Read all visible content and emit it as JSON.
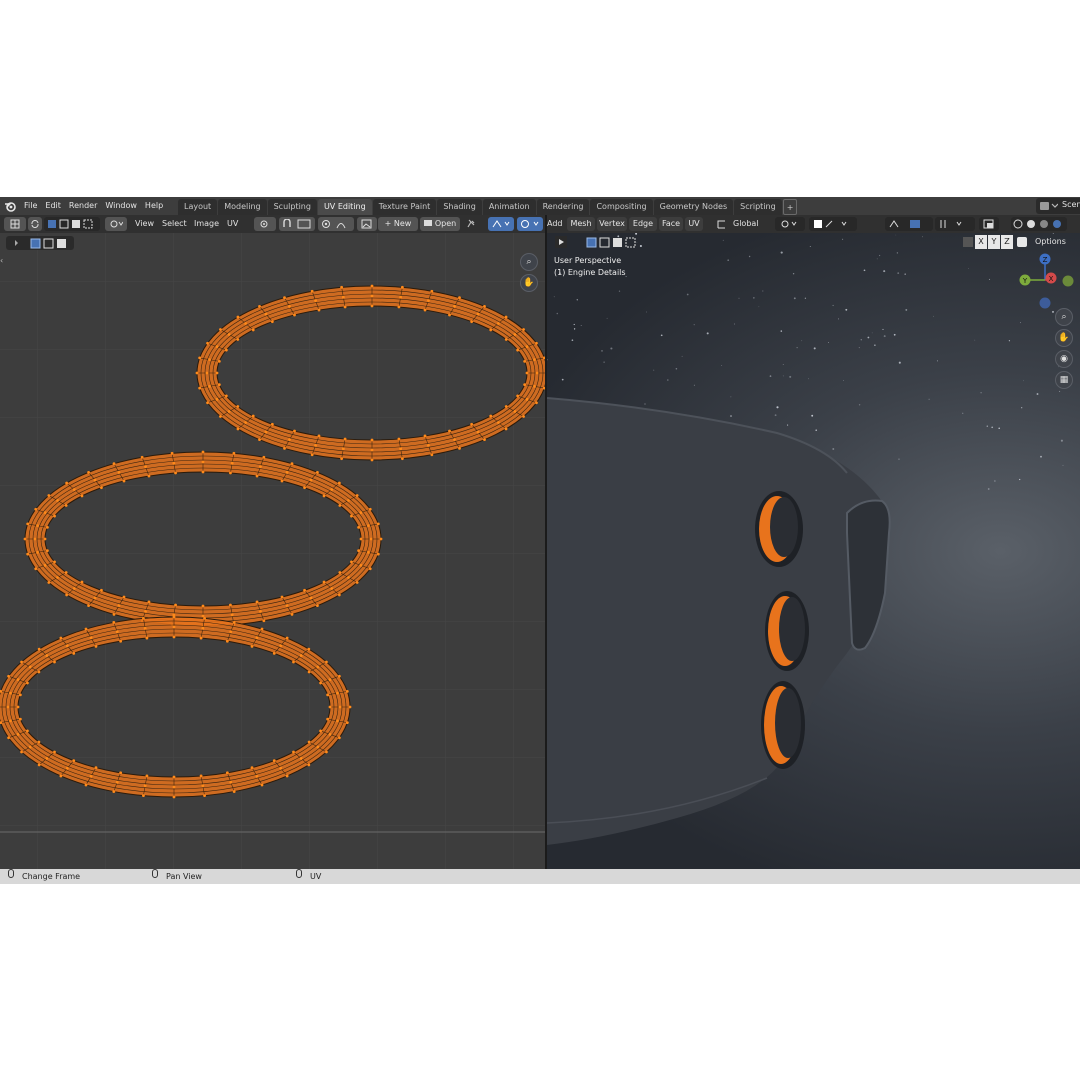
{
  "top_menu": [
    "File",
    "Edit",
    "Render",
    "Window",
    "Help"
  ],
  "workspace_tabs": [
    "Layout",
    "Modeling",
    "Sculpting",
    "UV Editing",
    "Texture Paint",
    "Shading",
    "Animation",
    "Rendering",
    "Compositing",
    "Geometry Nodes",
    "Scripting"
  ],
  "active_tab": "UV Editing",
  "add_tab_label": "+",
  "scene_label": "Scen",
  "uv_header": {
    "view": "View",
    "select": "Select",
    "image": "Image",
    "uv": "UV",
    "new_label": "New",
    "open_label": "Open"
  },
  "vp_header": {
    "add": "Add",
    "mesh": "Mesh",
    "vertex": "Vertex",
    "edge": "Edge",
    "face": "Face",
    "uv": "UV",
    "orientation": "Global",
    "options": "Options",
    "axis_x": "X",
    "axis_y": "Y",
    "axis_z": "Z"
  },
  "viewport_overlay": {
    "perspective": "User Perspective",
    "object": "(1) Engine Details"
  },
  "gizmo": {
    "x": "X",
    "y": "Y",
    "z": "Z"
  },
  "status_bar": {
    "left": "Change Frame",
    "middle": "Pan View",
    "right": "UV"
  },
  "colors": {
    "accent_orange": "#e8731c",
    "vertex_orange": "#ff8a1a",
    "active_blue": "#4772b3",
    "uv_background": "#3d3d3d",
    "hull_gray": "#3a3e45"
  }
}
